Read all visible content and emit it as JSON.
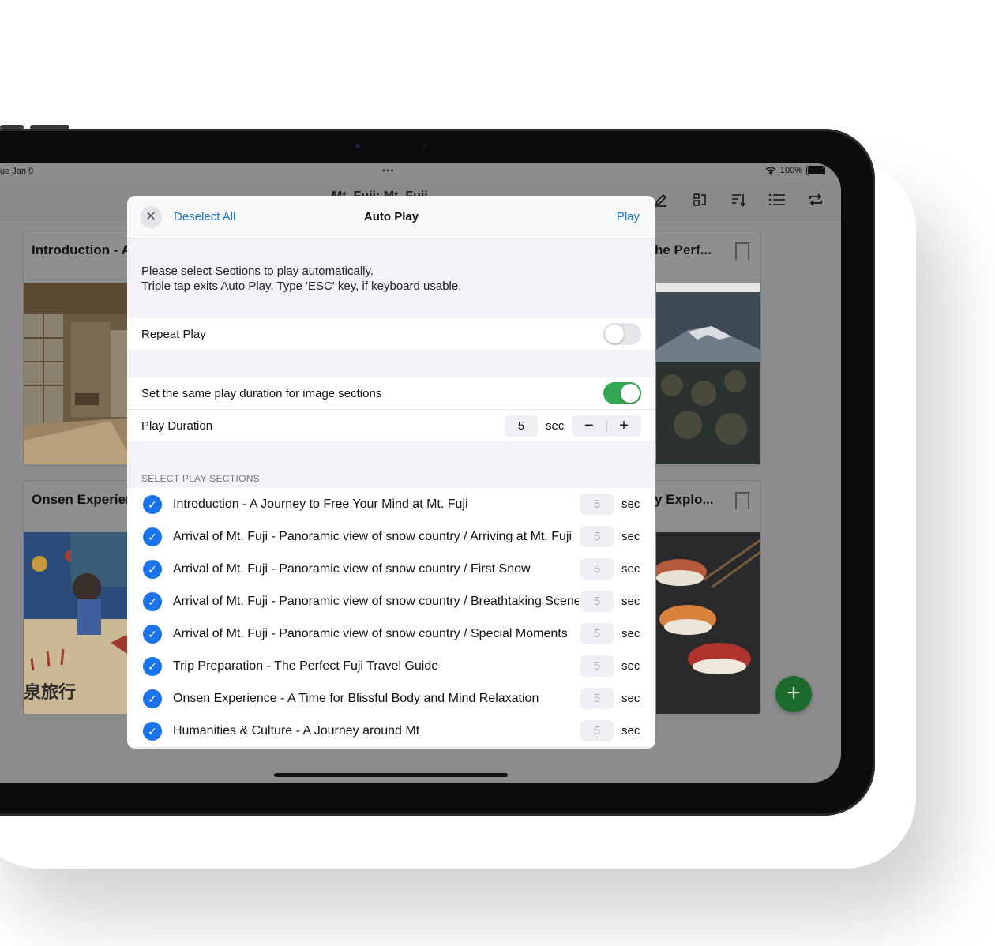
{
  "status": {
    "date": "ue Jan 9",
    "dots": "•••",
    "battery": "100%"
  },
  "toolbar": {
    "title": "Mt. Fuji: Mt. Fuji"
  },
  "cards": [
    {
      "title": "Introduction - A"
    },
    {
      "title": "he Perf..."
    },
    {
      "title": "Onsen Experien"
    },
    {
      "title": "y Explo..."
    }
  ],
  "cards_art": {
    "onsen_caption": "泉旅行"
  },
  "modal": {
    "deselect_label": "Deselect All",
    "title": "Auto Play",
    "play_label": "Play",
    "close_glyph": "✕",
    "desc_line1": "Please select Sections to play automatically.",
    "desc_line2": "Triple tap exits Auto Play. Type 'ESC' key, if keyboard usable.",
    "repeat_label": "Repeat Play",
    "repeat_on": false,
    "same_duration_label": "Set the same play duration for image sections",
    "same_duration_on": true,
    "duration_label": "Play Duration",
    "duration_value": "5",
    "duration_unit": "sec",
    "minus": "−",
    "plus": "+",
    "section_header": "SELECT PLAY SECTIONS",
    "check_glyph": "✓",
    "sections": [
      {
        "label": "Introduction - A Journey to Free Your Mind at Mt. Fuji",
        "value": "5",
        "unit": "sec"
      },
      {
        "label": "Arrival of Mt. Fuji - Panoramic view of snow country  / Arriving at Mt. Fuji",
        "value": "5",
        "unit": "sec"
      },
      {
        "label": "Arrival of Mt. Fuji - Panoramic view of snow country  / First Snow",
        "value": "5",
        "unit": "sec"
      },
      {
        "label": "Arrival of Mt. Fuji - Panoramic view of snow country  / Breathtaking Scenery",
        "value": "5",
        "unit": "sec"
      },
      {
        "label": "Arrival of Mt. Fuji - Panoramic view of snow country  / Special Moments",
        "value": "5",
        "unit": "sec"
      },
      {
        "label": "Trip Preparation - The Perfect Fuji Travel Guide",
        "value": "5",
        "unit": "sec"
      },
      {
        "label": "Onsen Experience - A Time for Blissful Body and Mind Relaxation",
        "value": "5",
        "unit": "sec"
      },
      {
        "label": "Humanities & Culture - A Journey around Mt",
        "value": "5",
        "unit": "sec"
      }
    ]
  },
  "fab": {
    "glyph": "+"
  },
  "colors": {
    "accent": "#1a73e8",
    "toggle_on": "#34a853",
    "fab": "#1d6b2c"
  }
}
